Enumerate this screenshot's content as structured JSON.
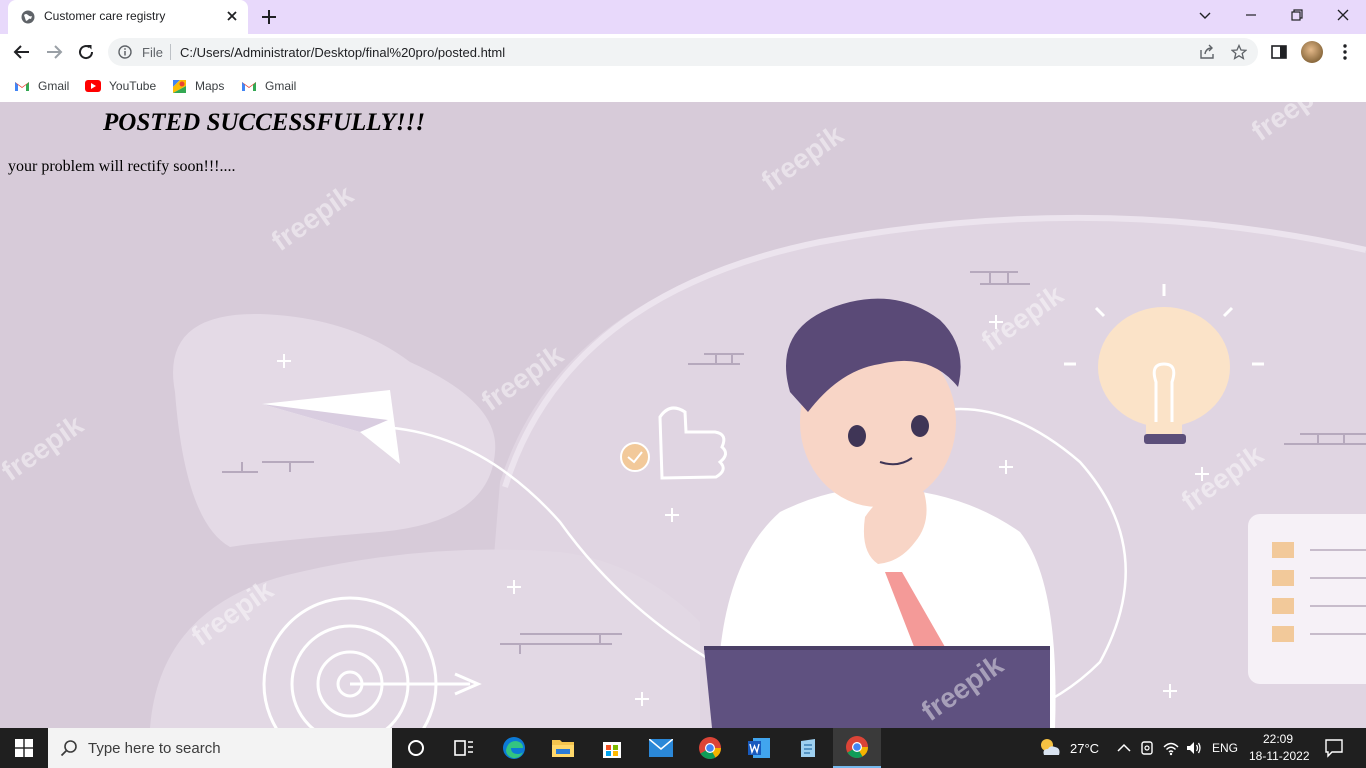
{
  "browser": {
    "tab": {
      "title": "Customer care registry"
    },
    "address_bar": {
      "scheme_label": "File",
      "url": "C:/Users/Administrator/Desktop/final%20pro/posted.html"
    },
    "bookmarks": [
      {
        "label": "Gmail",
        "icon": "gmail-icon"
      },
      {
        "label": "YouTube",
        "icon": "youtube-icon"
      },
      {
        "label": "Maps",
        "icon": "maps-icon"
      },
      {
        "label": "Gmail",
        "icon": "gmail-icon"
      }
    ]
  },
  "page": {
    "heading": "POSTED SUCCESSFULLY!!!",
    "message": "your problem will rectify soon!!!....",
    "watermark": "freepik"
  },
  "taskbar": {
    "search_placeholder": "Type here to search",
    "apps": [
      "task-view",
      "widgets",
      "edge",
      "file-explorer",
      "microsoft-store",
      "mail",
      "chrome",
      "word",
      "notepad",
      "chrome"
    ],
    "weather": "27°C",
    "language": "ENG",
    "time": "22:09",
    "date": "18-11-2022"
  },
  "colors": {
    "tab_strip": "#e8d9fb",
    "page_background": "#d7cbd9",
    "taskbar": "#1f1f1f",
    "accent": "#76b9ed"
  }
}
